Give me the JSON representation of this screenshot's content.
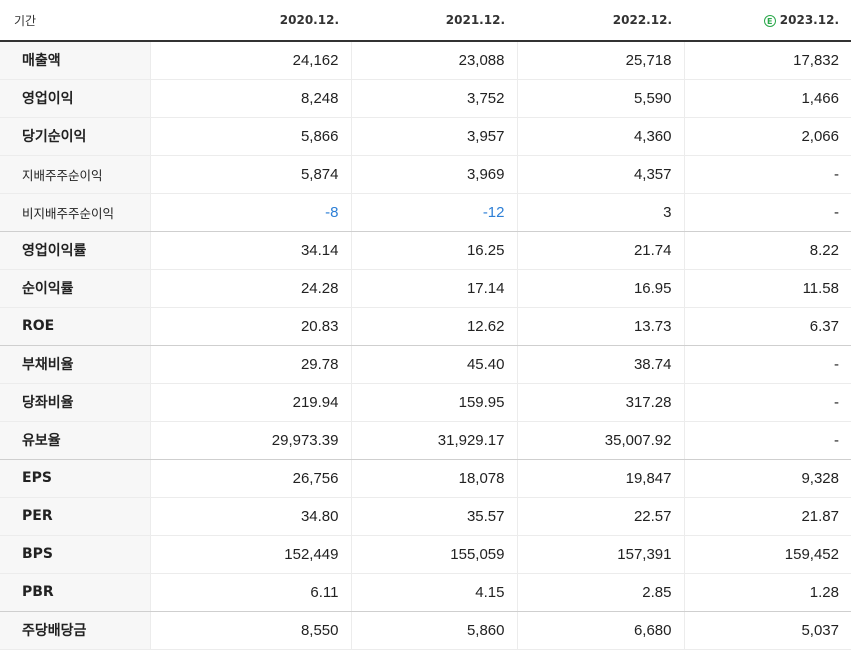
{
  "header": {
    "label": "기간",
    "years": [
      "2020.12.",
      "2021.12.",
      "2022.12.",
      "2023.12."
    ],
    "estimate_badge": "E"
  },
  "colors": {
    "negative": "#2d7fd6",
    "estimate_badge": "#2aa84a"
  },
  "rows": [
    {
      "label": "매출액",
      "values": [
        "24,162",
        "23,088",
        "25,718",
        "17,832"
      ]
    },
    {
      "label": "영업이익",
      "values": [
        "8,248",
        "3,752",
        "5,590",
        "1,466"
      ]
    },
    {
      "label": "당기순이익",
      "values": [
        "5,866",
        "3,957",
        "4,360",
        "2,066"
      ]
    },
    {
      "label": "지배주주순이익",
      "values": [
        "5,874",
        "3,969",
        "4,357",
        "-"
      ]
    },
    {
      "label": "비지배주주순이익",
      "values": [
        "-8",
        "-12",
        "3",
        "-"
      ]
    },
    {
      "label": "영업이익률",
      "values": [
        "34.14",
        "16.25",
        "21.74",
        "8.22"
      ]
    },
    {
      "label": "순이익률",
      "values": [
        "24.28",
        "17.14",
        "16.95",
        "11.58"
      ]
    },
    {
      "label": "ROE",
      "values": [
        "20.83",
        "12.62",
        "13.73",
        "6.37"
      ]
    },
    {
      "label": "부채비율",
      "values": [
        "29.78",
        "45.40",
        "38.74",
        "-"
      ]
    },
    {
      "label": "당좌비율",
      "values": [
        "219.94",
        "159.95",
        "317.28",
        "-"
      ]
    },
    {
      "label": "유보율",
      "values": [
        "29,973.39",
        "31,929.17",
        "35,007.92",
        "-"
      ]
    },
    {
      "label": "EPS",
      "values": [
        "26,756",
        "18,078",
        "19,847",
        "9,328"
      ]
    },
    {
      "label": "PER",
      "values": [
        "34.80",
        "35.57",
        "22.57",
        "21.87"
      ]
    },
    {
      "label": "BPS",
      "values": [
        "152,449",
        "155,059",
        "157,391",
        "159,452"
      ]
    },
    {
      "label": "PBR",
      "values": [
        "6.11",
        "4.15",
        "2.85",
        "1.28"
      ]
    },
    {
      "label": "주당배당금",
      "values": [
        "8,550",
        "5,860",
        "6,680",
        "5,037"
      ]
    }
  ]
}
